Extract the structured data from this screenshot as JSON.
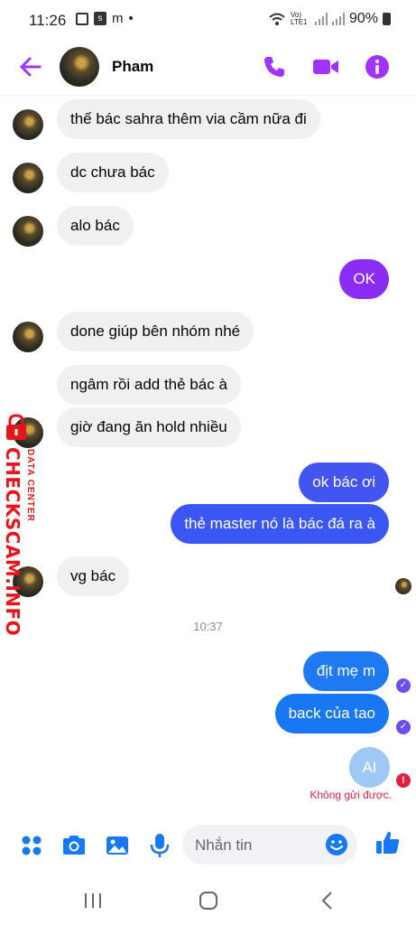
{
  "status": {
    "time": "11:26",
    "notif_m": "m",
    "dot": "•",
    "battery": "90%",
    "net": "Vo) LTE1"
  },
  "header": {
    "name": "Pham"
  },
  "messages": {
    "m1": "thế bác sahra thêm via cầm nữa đi",
    "m2": "dc chưa bác",
    "m3": "alo bác",
    "m4": "OK",
    "m5": "done giúp bên nhóm nhé",
    "m6": "ngâm   rồi add thẻ bác à",
    "m7": "giờ đang ăn hold nhiều",
    "m8": "ok bác ơi",
    "m9": "thẻ master nó là bác đá ra à",
    "m10": "vg bác",
    "time_sep": "10:37",
    "m11": "địt mẹ m",
    "m12": "back của tao",
    "m13": "AI",
    "failed": "Không gửi được."
  },
  "watermark": {
    "brand": "CHECKSCAM.INFO",
    "sub": "DATA CENTER"
  },
  "composer": {
    "placeholder": "Nhắn tin"
  },
  "colors": {
    "accent": "#a033ff",
    "blue": "#3a57f5",
    "purple": "#8b2cf5"
  }
}
